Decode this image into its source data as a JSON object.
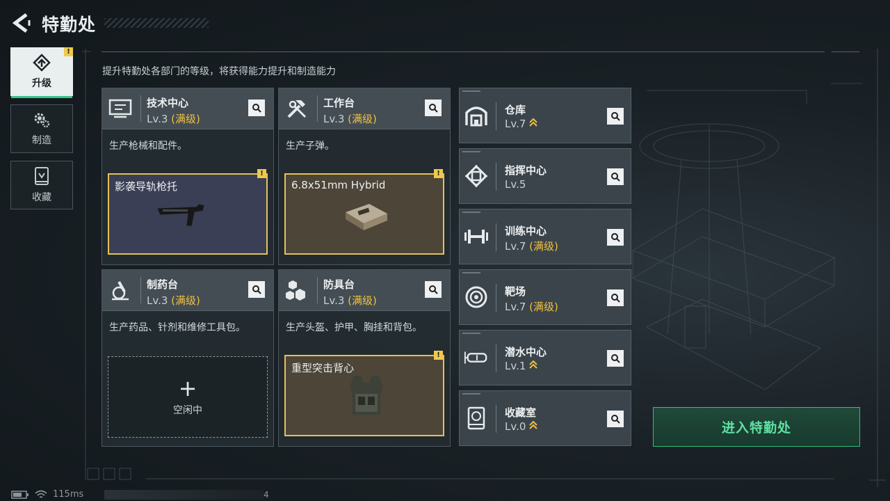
{
  "header": {
    "title": "特勤处"
  },
  "subtitle": "提升特勤处各部门的等级，将获得能力提升和制造能力",
  "nav": [
    {
      "label": "升级",
      "active": true,
      "badge": "!"
    },
    {
      "label": "制造",
      "active": false
    },
    {
      "label": "收藏",
      "active": false
    }
  ],
  "cards": [
    {
      "name": "技术中心",
      "level": "Lv.3",
      "status": "(满级)",
      "icon": "computer-icon",
      "desc": "生产枪械和配件。",
      "slot": {
        "item": "影袭导轨枪托",
        "badge": "!"
      }
    },
    {
      "name": "工作台",
      "level": "Lv.3",
      "status": "(满级)",
      "icon": "tools-icon",
      "desc": "生产子弹。",
      "slot": {
        "item": "6.8x51mm Hybrid",
        "badge": "!"
      }
    },
    {
      "name": "制药台",
      "level": "Lv.3",
      "status": "(满级)",
      "icon": "microscope-icon",
      "desc": "生产药品、针剂和维修工具包。",
      "slot": {
        "empty_label": "空闲中",
        "plus": "+"
      }
    },
    {
      "name": "防具台",
      "level": "Lv.3",
      "status": "(满级)",
      "icon": "blocks-icon",
      "desc": "生产头盔、护甲、胸挂和背包。",
      "slot": {
        "item": "重型突击背心",
        "badge": "!"
      }
    }
  ],
  "small_cards": [
    {
      "name": "仓库",
      "level": "Lv.7",
      "status": "",
      "icon": "warehouse-icon",
      "upgrade": true
    },
    {
      "name": "指挥中心",
      "level": "Lv.5",
      "status": "",
      "icon": "chip-icon",
      "upgrade": false
    },
    {
      "name": "训练中心",
      "level": "Lv.7",
      "status": "(满级)",
      "icon": "dumbbell-icon",
      "upgrade": false
    },
    {
      "name": "靶场",
      "level": "Lv.7",
      "status": "(满级)",
      "icon": "target-icon",
      "upgrade": false
    },
    {
      "name": "潜水中心",
      "level": "Lv.1",
      "status": "",
      "icon": "goggles-icon",
      "upgrade": true
    },
    {
      "name": "收藏室",
      "level": "Lv.0",
      "status": "",
      "icon": "vault-icon",
      "upgrade": true
    }
  ],
  "enter_button": "进入特勤处",
  "status_bar": {
    "ping": "115ms",
    "count": "4"
  },
  "colors": {
    "accent": "#35c78a",
    "gold": "#f0c13f",
    "slot_border": "#e5c15a"
  }
}
